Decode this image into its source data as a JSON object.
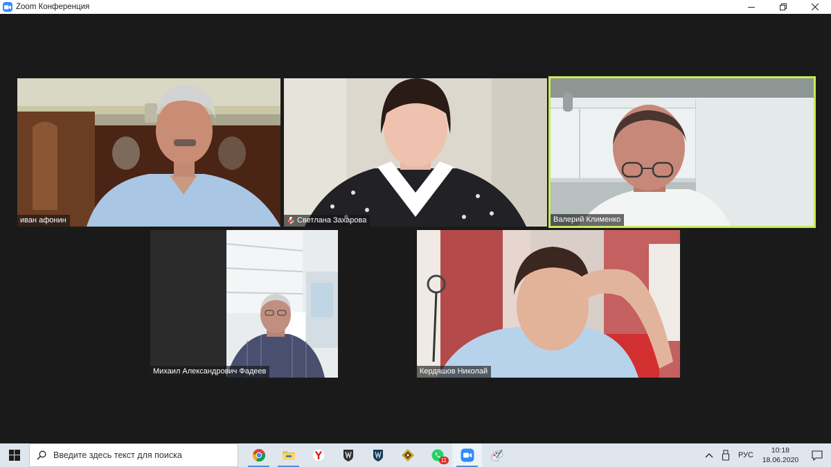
{
  "window": {
    "title": "Zoom Конференция"
  },
  "participants": [
    {
      "name": "иван афонин",
      "muted": false,
      "active_speaker": false
    },
    {
      "name": "Светлана Захарова",
      "muted": true,
      "active_speaker": false
    },
    {
      "name": "Валерий Клименко",
      "muted": false,
      "active_speaker": true
    },
    {
      "name": "Михаил Александрович Фадеев",
      "muted": false,
      "active_speaker": false
    },
    {
      "name": "Кердяшов Николай",
      "muted": false,
      "active_speaker": false
    }
  ],
  "taskbar": {
    "search_placeholder": "Введите здесь текст для поиска",
    "apps": [
      {
        "icon": "chrome-icon"
      },
      {
        "icon": "file-explorer-icon"
      },
      {
        "icon": "yandex-browser-icon"
      },
      {
        "icon": "world-of-tanks-icon"
      },
      {
        "icon": "world-of-warships-icon"
      },
      {
        "icon": "game-launcher-icon"
      },
      {
        "icon": "whatsapp-icon",
        "badge": "11"
      },
      {
        "icon": "zoom-icon"
      },
      {
        "icon": "paint-icon"
      }
    ],
    "tray": {
      "language": "РУС",
      "time": "10:18",
      "date": "18.06.2020"
    }
  },
  "colors": {
    "active_speaker_border": "#c8eb57",
    "meeting_background": "#1a1a1a",
    "taskbar": "#dfe6ee",
    "zoom_blue": "#2d8cff"
  }
}
